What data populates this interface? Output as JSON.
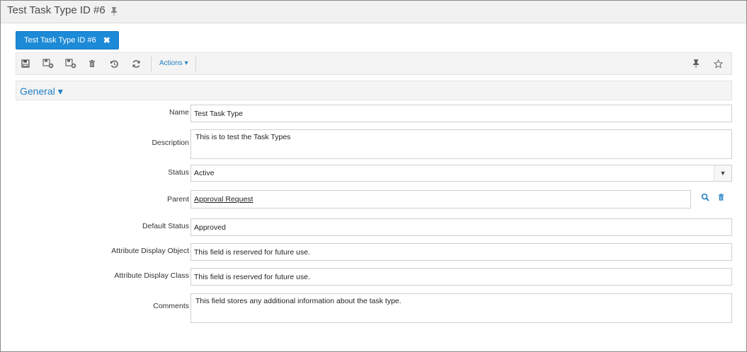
{
  "window": {
    "title": "Test Task Type ID #6"
  },
  "tab": {
    "label": "Test Task Type ID #6"
  },
  "toolbar": {
    "actions_label": "Actions ▾",
    "icons": [
      "save-icon",
      "save-and-close-icon",
      "save-and-new-icon",
      "delete-icon",
      "undo-icon",
      "refresh-icon",
      "pin-icon",
      "star-icon"
    ]
  },
  "section": {
    "title": "General ▾"
  },
  "form": {
    "name": {
      "label": "Name",
      "value": "Test Task Type"
    },
    "description": {
      "label": "Description",
      "value": "This is to test the Task Types"
    },
    "status": {
      "label": "Status",
      "value": "Active"
    },
    "parent": {
      "label": "Parent",
      "value": "Approval Request"
    },
    "default_status": {
      "label": "Default Status",
      "value": "Approved"
    },
    "attr_display_object": {
      "label": "Attribute Display Object",
      "value": "This field is reserved for future use."
    },
    "attr_display_class": {
      "label": "Attribute Display Class",
      "value": "This field is reserved for future use."
    },
    "comments": {
      "label": "Comments",
      "value": "This field stores any additional information about the task type."
    }
  },
  "colors": {
    "accent": "#1c8ad6",
    "link": "#1f7fc4"
  }
}
